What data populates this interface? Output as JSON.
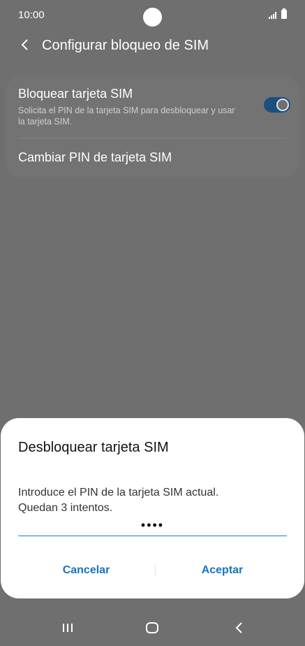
{
  "status_bar": {
    "time": "10:00",
    "icons": [
      "camera-cutout",
      "signal-icon",
      "battery-icon"
    ]
  },
  "header": {
    "title": "Configurar bloqueo de SIM",
    "back_icon": "chevron-left-icon"
  },
  "settings": {
    "lock_sim": {
      "title": "Bloquear tarjeta SIM",
      "subtitle": "Solicita el PIN de la tarjeta SIM para desbloquear y usar la tarjeta SIM.",
      "toggle_on": true
    },
    "change_pin": {
      "title": "Cambiar PIN de tarjeta SIM"
    }
  },
  "dialog": {
    "title": "Desbloquear tarjeta SIM",
    "message_line1": "Introduce el PIN de la tarjeta SIM actual.",
    "message_line2": "Quedan 3 intentos.",
    "pin_value": "••••",
    "cancel_label": "Cancelar",
    "accept_label": "Aceptar"
  },
  "nav_bar": {
    "icons": [
      "recent-apps-icon",
      "home-icon",
      "back-icon"
    ]
  },
  "colors": {
    "accent": "#1673c3",
    "toggle_track": "#1c4f7c",
    "scrim": "#6f6f6f",
    "sheet": "#ffffff"
  }
}
